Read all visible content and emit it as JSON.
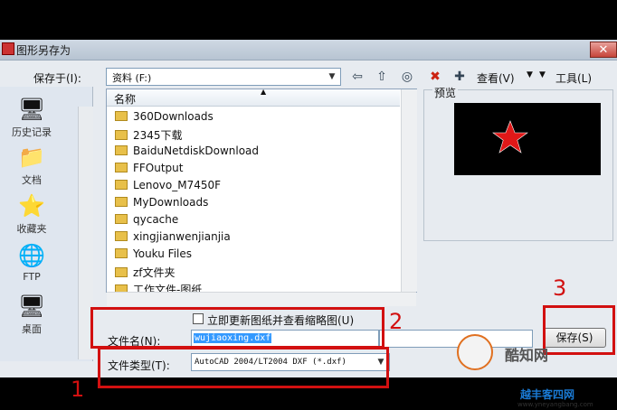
{
  "window": {
    "title": "图形另存为",
    "close_symbol": "✕"
  },
  "toolbar": {
    "save_in_label": "保存于(I):",
    "save_in_value": "资料 (F:)",
    "view_label": "查看(V)",
    "tools_label": "工具(L)"
  },
  "places": [
    {
      "label": "历史记录",
      "icon": "history-icon"
    },
    {
      "label": "文档",
      "icon": "documents-icon"
    },
    {
      "label": "收藏夹",
      "icon": "favorites-icon"
    },
    {
      "label": "FTP",
      "icon": "ftp-icon"
    },
    {
      "label": "桌面",
      "icon": "desktop-icon"
    }
  ],
  "file_list": {
    "column_name": "名称",
    "items": [
      "360Downloads",
      "2345下载",
      "BaiduNetdiskDownload",
      "FFOutput",
      "Lenovo_M7450F",
      "MyDownloads",
      "qycache",
      "xingjianwenjianjia",
      "Youku Files",
      "zf文件夹",
      "工作文件-图纸"
    ]
  },
  "preview": {
    "label": "预览"
  },
  "update_checkbox": {
    "label": "立即更新图纸并查看缩略图(U)",
    "checked": false
  },
  "filename": {
    "label": "文件名(N):",
    "value": "wujiaoxing.dxf"
  },
  "filetype": {
    "label": "文件类型(T):",
    "value": "AutoCAD 2004/LT2004 DXF (*.dxf)"
  },
  "save_button": {
    "label": "保存(S)"
  },
  "annotations": {
    "box1": "1",
    "box2": "2",
    "box3": "3"
  },
  "watermark": {
    "brand": "酷知网",
    "url": "www.yneyangbang.com",
    "sub": "越丰客四网"
  },
  "colors": {
    "annotation_red": "#d21010",
    "selection_blue": "#3399ff",
    "star_red": "#e01818"
  }
}
